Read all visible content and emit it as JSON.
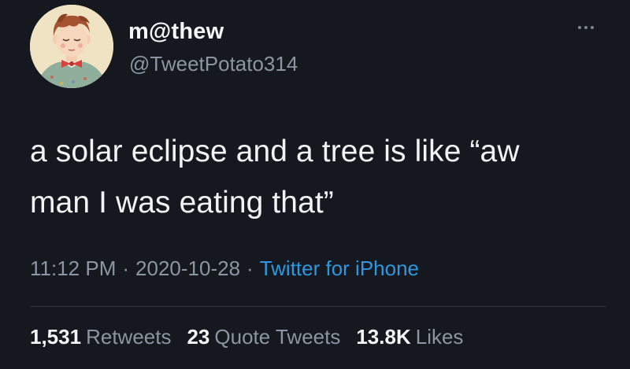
{
  "author": {
    "display_name": "m@thew",
    "handle": "@TweetPotato314",
    "avatar_icon": "cartoon-child-avatar"
  },
  "menu_icon": "more-options-icon",
  "tweet": {
    "text": "a solar eclipse and a tree is like “aw\nman I was eating that”"
  },
  "meta": {
    "time": "11:12 PM",
    "date": "2020-10-28",
    "separator": "·",
    "source": "Twitter for iPhone"
  },
  "stats": {
    "retweets_count": "1,531",
    "retweets_label": "Retweets",
    "quotes_count": "23",
    "quotes_label": "Quote Tweets",
    "likes_count": "13.8K",
    "likes_label": "Likes"
  },
  "colors": {
    "background": "#15181f",
    "link": "#2d98df",
    "secondary_text": "#8b96a1"
  }
}
